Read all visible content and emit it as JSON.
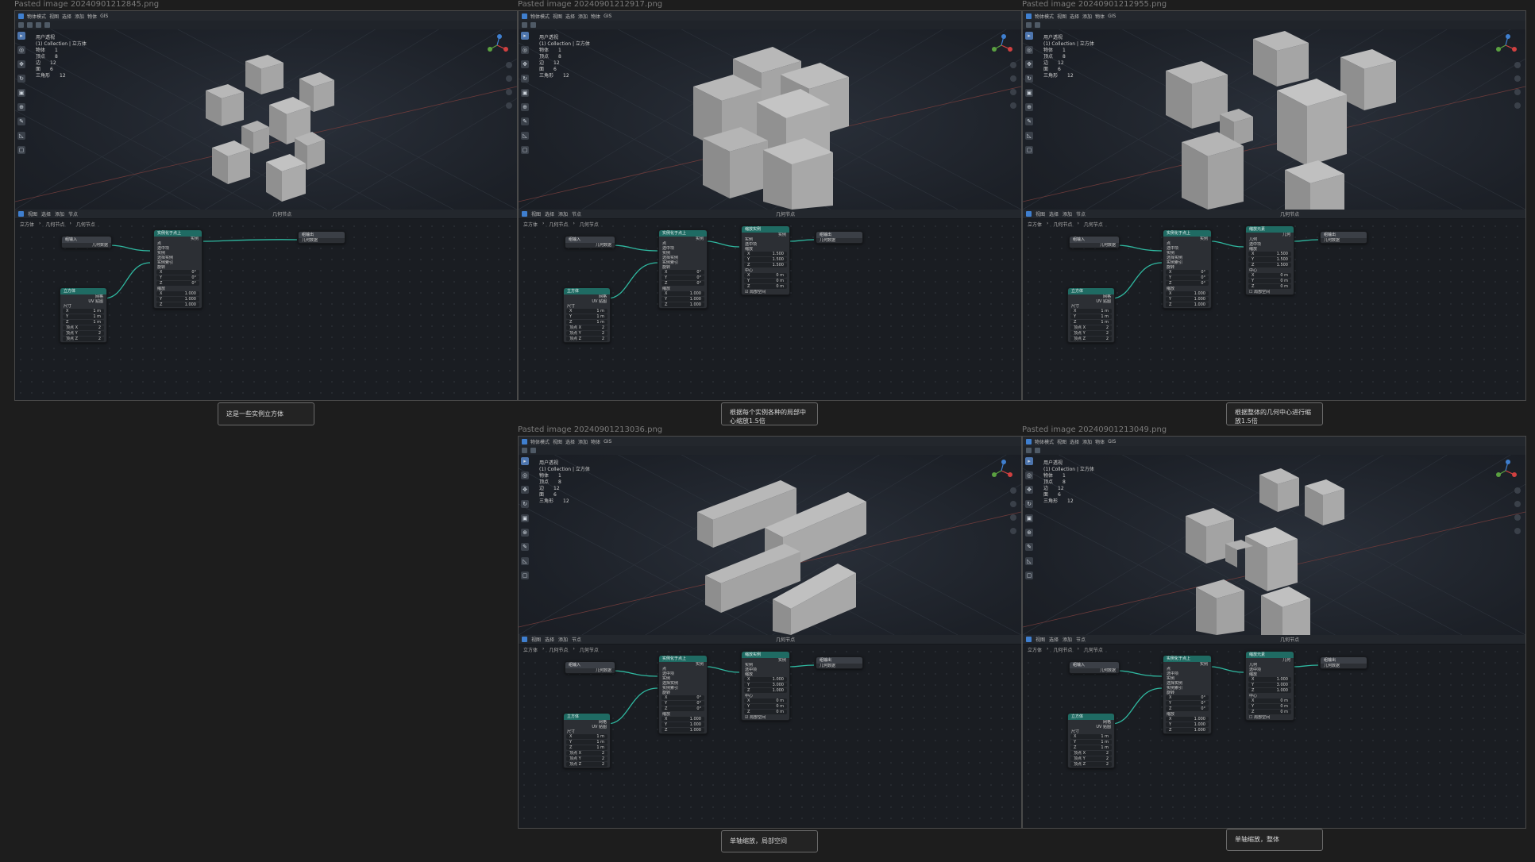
{
  "panels": [
    {
      "file_title": "Pasted image 20240901212845.png",
      "menu": [
        "物体模式",
        "视图",
        "选择",
        "添加",
        "物体",
        "GIS"
      ],
      "scene_label": "用户透视",
      "collection": "(1) Collection | 立方体",
      "stats": [
        [
          "物体",
          "1"
        ],
        [
          "顶点",
          "8"
        ],
        [
          "边",
          "12"
        ],
        [
          "面",
          "6"
        ],
        [
          "三角形",
          "12"
        ]
      ],
      "editor_menu": [
        "视图",
        "选择",
        "添加",
        "节点"
      ],
      "editor_type": "几何节点",
      "breadcrumb": [
        "立方体",
        "几何节点",
        "几何节点"
      ],
      "caption": "这是一些实例立方体",
      "nodes": {
        "input": {
          "title": "组输入",
          "out": "几何数据"
        },
        "cube": {
          "title": "立方体",
          "out1": "网格",
          "out2": "UV 贴图",
          "size": "尺寸",
          "x": "1 m",
          "y": "1 m",
          "z": "1 m",
          "vx": "顶点 X",
          "vy": "顶点 Y",
          "vz": "顶点 Z",
          "vval": "2"
        },
        "instance": {
          "title": "实例化于点上",
          "out": "实例",
          "rows": [
            "点",
            "选中项",
            "实例",
            "选择实例",
            "实例索引",
            "旋转"
          ],
          "rot": [
            "0°",
            "0°",
            "0°"
          ],
          "scale_label": "缩放",
          "scale": [
            "1.000",
            "1.000",
            "1.000"
          ]
        },
        "output": {
          "title": "组输出",
          "in": "几何数据"
        }
      }
    },
    {
      "file_title": "Pasted image 20240901212917.png",
      "caption": "根据每个实例各种的局部中心缩放1.5倍",
      "scale_node": {
        "title": "缩放实例",
        "rows": [
          "实例",
          "选中项",
          "缩放"
        ],
        "scale": [
          "1.500",
          "1.500",
          "1.500"
        ],
        "center_label": "中心",
        "center": [
          "0 m",
          "0 m",
          "0 m"
        ],
        "local": "局部空间"
      }
    },
    {
      "file_title": "Pasted image 20240901212955.png",
      "caption": "根据整体的几何中心进行缩放1.5倍",
      "scale_node": {
        "title": "缩放元素",
        "rows": [
          "几何",
          "选中项",
          "缩放"
        ],
        "scale": [
          "1.500",
          "1.500",
          "1.500"
        ],
        "center_label": "中心",
        "center": [
          "0 m",
          "0 m",
          "0 m"
        ],
        "local": "局部空间"
      }
    },
    {
      "file_title": "Pasted image 20240901213036.png",
      "caption": "单轴缩放，局部空间",
      "scale_node": {
        "title": "缩放实例",
        "rows": [
          "实例",
          "选中项",
          "缩放"
        ],
        "scale": [
          "1.000",
          "3.000",
          "1.000"
        ],
        "center_label": "中心",
        "center": [
          "0 m",
          "0 m",
          "0 m"
        ],
        "local": "局部空间"
      }
    },
    {
      "file_title": "Pasted image 20240901213049.png",
      "caption": "单轴缩放，整体",
      "scale_node": {
        "title": "缩放元素",
        "rows": [
          "几何",
          "选中项",
          "缩放"
        ],
        "scale": [
          "1.000",
          "3.000",
          "1.000"
        ],
        "center_label": "中心",
        "center": [
          "0 m",
          "0 m",
          "0 m"
        ],
        "local": "局部空间"
      }
    }
  ],
  "colors": {
    "link": "#2fb8a0",
    "teal_header": "#1f6b63",
    "cube_light": "#b5b5b5",
    "cube_mid": "#9a9a9a",
    "cube_dark": "#7c7c7c"
  },
  "icons": [
    "select-icon",
    "cursor-icon",
    "move-icon",
    "rotate-icon",
    "scale-icon",
    "transform-icon",
    "annotate-icon",
    "measure-icon",
    "add-cube-icon"
  ]
}
